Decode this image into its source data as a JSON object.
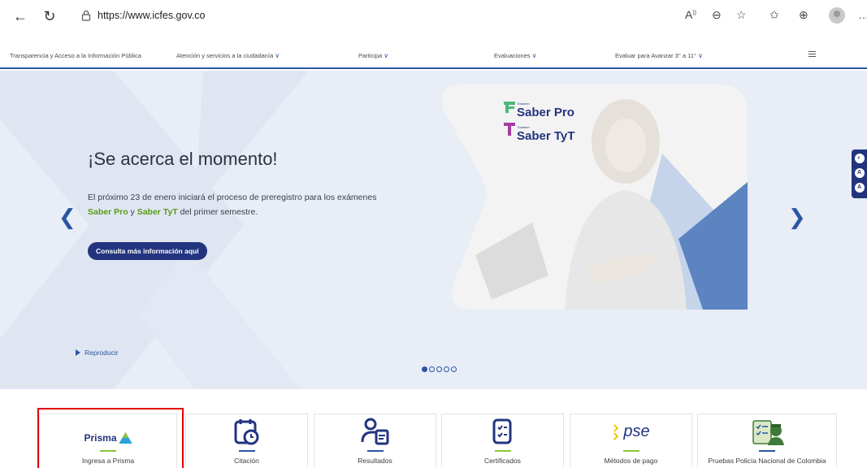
{
  "browser": {
    "url": "https://www.icfes.gov.co",
    "back_icon": "arrow-left-icon",
    "refresh_icon": "refresh-icon",
    "lock_icon": "lock-icon",
    "toolbar_icons": [
      "read-aloud-icon",
      "zoom-icon",
      "favorite-add-icon",
      "favorites-icon",
      "collections-icon",
      "profile-avatar",
      "more-icon"
    ]
  },
  "nav": {
    "items": [
      {
        "label": "Transparencia y Acceso a la Información Pública",
        "dropdown": false
      },
      {
        "label": "Atención y servicios a la ciudadanía",
        "dropdown": true
      },
      {
        "label": "Participa",
        "dropdown": true
      },
      {
        "label": "Evaluaciones",
        "dropdown": true
      },
      {
        "label": "Evaluar para Avanzar 3° a 11°",
        "dropdown": true
      }
    ],
    "chevron": "∨"
  },
  "hero": {
    "title": "¡Se acerca el momento!",
    "desc_prefix": "El próximo 23 de enero iniciará el proceso de preregistro para los exámenes",
    "hl1": "Saber Pro",
    "mid": " y ",
    "hl2": "Saber TyT",
    "desc_suffix": " del primer semestre.",
    "cta": "Consulta más información aquí",
    "play": "Reproducir",
    "logo1_small": "Examen",
    "logo1": "Saber Pro",
    "logo2_small": "Examen",
    "logo2": "Saber TyT",
    "prev": "❮",
    "next": "❯",
    "slides": 5,
    "active_slide": 1
  },
  "a11y": [
    "◐",
    "A",
    "A"
  ],
  "cards": [
    {
      "label": "Ingresa a Prisma",
      "title": "Prisma",
      "accent": "#8bc53f"
    },
    {
      "label": "Citación",
      "accent": "#2a55a3"
    },
    {
      "label": "Resultados",
      "accent": "#2a55a3"
    },
    {
      "label": "Certificados",
      "accent": "#8bc53f"
    },
    {
      "label": "Métodos de pago",
      "title": "pse",
      "accent": "#8bc53f"
    },
    {
      "label": "Pruebas Policía Nacional de Colombia",
      "accent": "#2a55a3"
    }
  ],
  "colors": {
    "primary": "#23347f",
    "accent_green": "#8bc53f",
    "hero_bg": "#e8edf6"
  }
}
